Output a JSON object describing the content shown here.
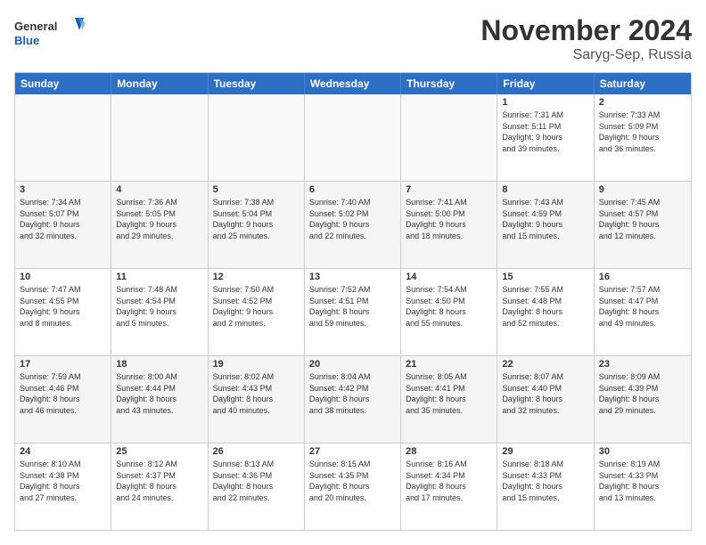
{
  "header": {
    "logo_general": "General",
    "logo_blue": "Blue",
    "month_title": "November 2024",
    "location": "Saryg-Sep, Russia"
  },
  "days_of_week": [
    "Sunday",
    "Monday",
    "Tuesday",
    "Wednesday",
    "Thursday",
    "Friday",
    "Saturday"
  ],
  "rows": [
    {
      "cells": [
        {
          "day": "",
          "info": ""
        },
        {
          "day": "",
          "info": ""
        },
        {
          "day": "",
          "info": ""
        },
        {
          "day": "",
          "info": ""
        },
        {
          "day": "",
          "info": ""
        },
        {
          "day": "1",
          "info": "Sunrise: 7:31 AM\nSunset: 5:11 PM\nDaylight: 9 hours\nand 39 minutes."
        },
        {
          "day": "2",
          "info": "Sunrise: 7:33 AM\nSunset: 5:09 PM\nDaylight: 9 hours\nand 36 minutes."
        }
      ]
    },
    {
      "cells": [
        {
          "day": "3",
          "info": "Sunrise: 7:34 AM\nSunset: 5:07 PM\nDaylight: 9 hours\nand 32 minutes."
        },
        {
          "day": "4",
          "info": "Sunrise: 7:36 AM\nSunset: 5:05 PM\nDaylight: 9 hours\nand 29 minutes."
        },
        {
          "day": "5",
          "info": "Sunrise: 7:38 AM\nSunset: 5:04 PM\nDaylight: 9 hours\nand 25 minutes."
        },
        {
          "day": "6",
          "info": "Sunrise: 7:40 AM\nSunset: 5:02 PM\nDaylight: 9 hours\nand 22 minutes."
        },
        {
          "day": "7",
          "info": "Sunrise: 7:41 AM\nSunset: 5:00 PM\nDaylight: 9 hours\nand 18 minutes."
        },
        {
          "day": "8",
          "info": "Sunrise: 7:43 AM\nSunset: 4:59 PM\nDaylight: 9 hours\nand 15 minutes."
        },
        {
          "day": "9",
          "info": "Sunrise: 7:45 AM\nSunset: 4:57 PM\nDaylight: 9 hours\nand 12 minutes."
        }
      ]
    },
    {
      "cells": [
        {
          "day": "10",
          "info": "Sunrise: 7:47 AM\nSunset: 4:55 PM\nDaylight: 9 hours\nand 8 minutes."
        },
        {
          "day": "11",
          "info": "Sunrise: 7:48 AM\nSunset: 4:54 PM\nDaylight: 9 hours\nand 5 minutes."
        },
        {
          "day": "12",
          "info": "Sunrise: 7:50 AM\nSunset: 4:52 PM\nDaylight: 9 hours\nand 2 minutes."
        },
        {
          "day": "13",
          "info": "Sunrise: 7:52 AM\nSunset: 4:51 PM\nDaylight: 8 hours\nand 59 minutes."
        },
        {
          "day": "14",
          "info": "Sunrise: 7:54 AM\nSunset: 4:50 PM\nDaylight: 8 hours\nand 55 minutes."
        },
        {
          "day": "15",
          "info": "Sunrise: 7:55 AM\nSunset: 4:48 PM\nDaylight: 8 hours\nand 52 minutes."
        },
        {
          "day": "16",
          "info": "Sunrise: 7:57 AM\nSunset: 4:47 PM\nDaylight: 8 hours\nand 49 minutes."
        }
      ]
    },
    {
      "cells": [
        {
          "day": "17",
          "info": "Sunrise: 7:59 AM\nSunset: 4:46 PM\nDaylight: 8 hours\nand 46 minutes."
        },
        {
          "day": "18",
          "info": "Sunrise: 8:00 AM\nSunset: 4:44 PM\nDaylight: 8 hours\nand 43 minutes."
        },
        {
          "day": "19",
          "info": "Sunrise: 8:02 AM\nSunset: 4:43 PM\nDaylight: 8 hours\nand 40 minutes."
        },
        {
          "day": "20",
          "info": "Sunrise: 8:04 AM\nSunset: 4:42 PM\nDaylight: 8 hours\nand 38 minutes."
        },
        {
          "day": "21",
          "info": "Sunrise: 8:05 AM\nSunset: 4:41 PM\nDaylight: 8 hours\nand 35 minutes."
        },
        {
          "day": "22",
          "info": "Sunrise: 8:07 AM\nSunset: 4:40 PM\nDaylight: 8 hours\nand 32 minutes."
        },
        {
          "day": "23",
          "info": "Sunrise: 8:09 AM\nSunset: 4:39 PM\nDaylight: 8 hours\nand 29 minutes."
        }
      ]
    },
    {
      "cells": [
        {
          "day": "24",
          "info": "Sunrise: 8:10 AM\nSunset: 4:38 PM\nDaylight: 8 hours\nand 27 minutes."
        },
        {
          "day": "25",
          "info": "Sunrise: 8:12 AM\nSunset: 4:37 PM\nDaylight: 8 hours\nand 24 minutes."
        },
        {
          "day": "26",
          "info": "Sunrise: 8:13 AM\nSunset: 4:36 PM\nDaylight: 8 hours\nand 22 minutes."
        },
        {
          "day": "27",
          "info": "Sunrise: 8:15 AM\nSunset: 4:35 PM\nDaylight: 8 hours\nand 20 minutes."
        },
        {
          "day": "28",
          "info": "Sunrise: 8:16 AM\nSunset: 4:34 PM\nDaylight: 8 hours\nand 17 minutes."
        },
        {
          "day": "29",
          "info": "Sunrise: 8:18 AM\nSunset: 4:33 PM\nDaylight: 8 hours\nand 15 minutes."
        },
        {
          "day": "30",
          "info": "Sunrise: 8:19 AM\nSunset: 4:33 PM\nDaylight: 8 hours\nand 13 minutes."
        }
      ]
    }
  ]
}
